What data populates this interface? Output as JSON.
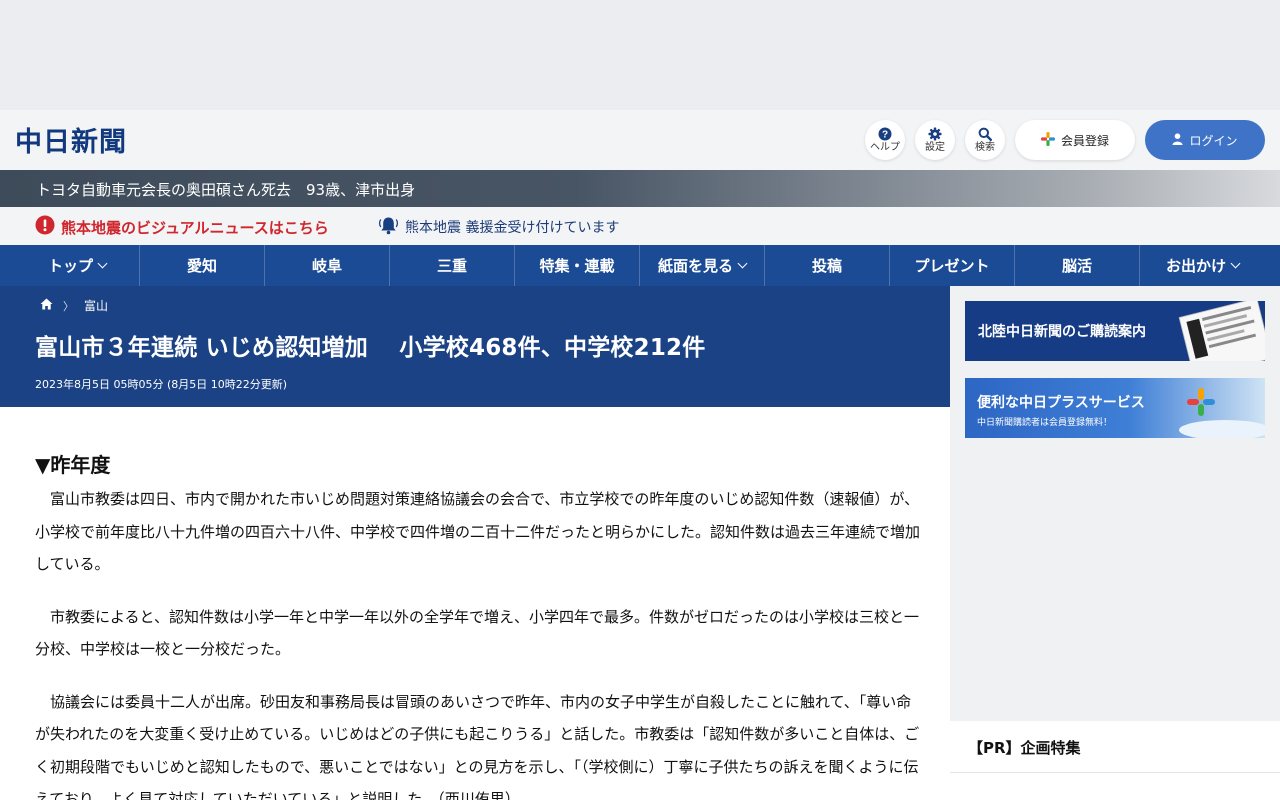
{
  "header": {
    "logo": "中日新聞",
    "buttons": {
      "help": "ヘルプ",
      "settings": "設定",
      "search": "検索",
      "register": "会員登録",
      "login": "ログイン"
    }
  },
  "breaking": {
    "text": "トヨタ自動車元会長の奥田碩さん死去　93歳、津市出身"
  },
  "alerts": {
    "visual": "熊本地震のビジュアルニュースはこちら",
    "donation": "熊本地震 義援金受け付けています"
  },
  "nav": [
    {
      "label": "トップ",
      "dropdown": true
    },
    {
      "label": "愛知",
      "dropdown": false
    },
    {
      "label": "岐阜",
      "dropdown": false
    },
    {
      "label": "三重",
      "dropdown": false
    },
    {
      "label": "特集・連載",
      "dropdown": false
    },
    {
      "label": "紙面を見る",
      "dropdown": true
    },
    {
      "label": "投稿",
      "dropdown": false
    },
    {
      "label": "プレゼント",
      "dropdown": false
    },
    {
      "label": "脳活",
      "dropdown": false
    },
    {
      "label": "お出かけ",
      "dropdown": true
    }
  ],
  "article": {
    "breadcrumb": "富山",
    "title": "富山市３年連続 いじめ認知増加　 小学校468件、中学校212件",
    "date": "2023年8月5日 05時05分 (8月5日 10時22分更新)",
    "subheading": "▼昨年度",
    "paragraphs": [
      "富山市教委は四日、市内で開かれた市いじめ問題対策連絡協議会の会合で、市立学校での昨年度のいじめ認知件数（速報値）が、小学校で前年度比八十九件増の四百六十八件、中学校で四件増の二百十二件だったと明らかにした。認知件数は過去三年連続で増加している。",
      "市教委によると、認知件数は小学一年と中学一年以外の全学年で増え、小学四年で最多。件数がゼロだったのは小学校は三校と一分校、中学校は一校と一分校だった。",
      "協議会には委員十二人が出席。砂田友和事務局長は冒頭のあいさつで昨年、市内の女子中学生が自殺したことに触れて、「尊い命が失われたのを大変重く受け止めている。いじめはどの子供にも起こりうる」と話した。市教委は「認知件数が多いこと自体は、ごく初期段階でもいじめと認知したもので、悪いことではない」との見方を示し、「（学校側に）丁寧に子供たちの訴えを聞くように伝えており、よく見て対応していただいている」と説明した。（西川侑里）"
    ]
  },
  "sidebar": {
    "banner1": "北陸中日新聞のご購読案内",
    "banner2_title": "便利な中日プラスサービス",
    "banner2_sub": "中日新聞購読者は会員登録無料！",
    "pr_title": "【PR】企画特集"
  },
  "colors": {
    "brand": "#12397d",
    "nav": "#1c4b96",
    "hero": "#1a4284",
    "login": "#3e73c8",
    "alert": "#d0262d"
  }
}
